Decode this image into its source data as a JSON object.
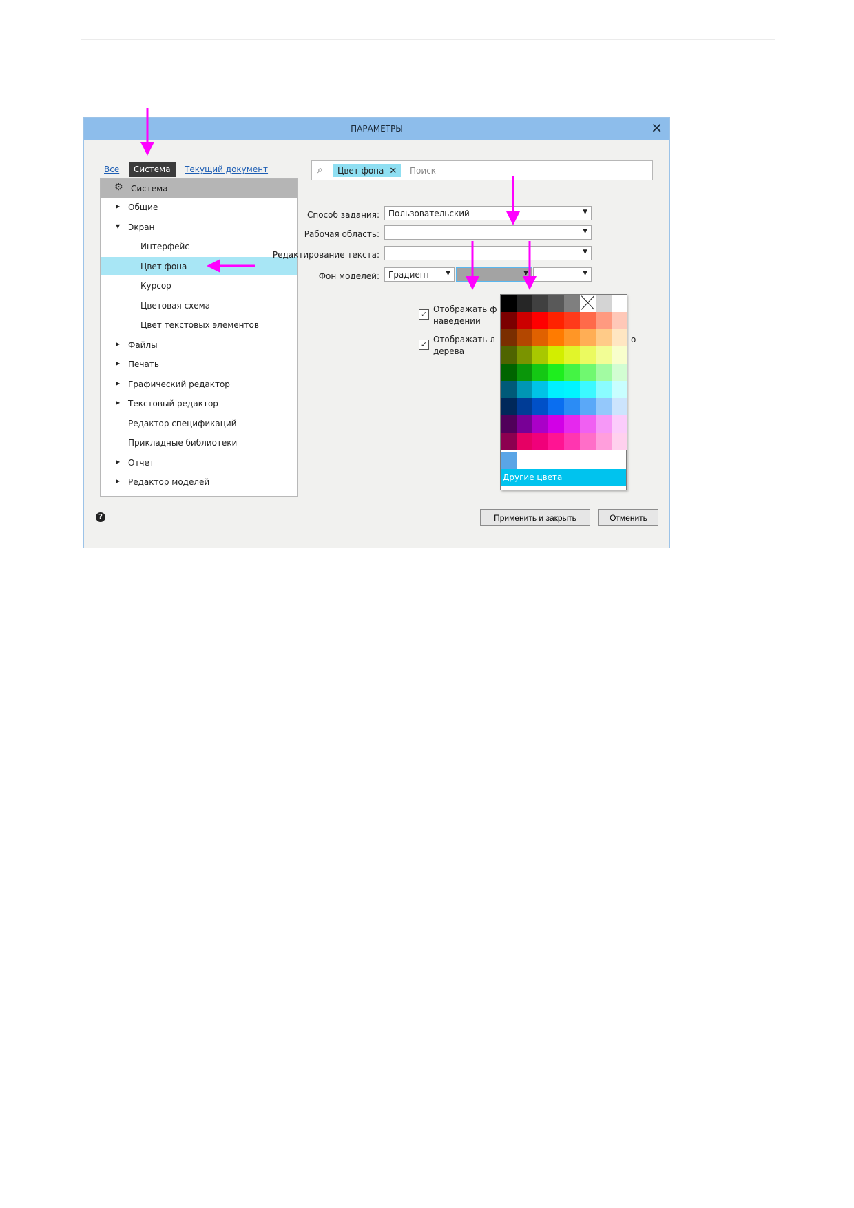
{
  "dialog": {
    "title": "ПАРАМЕТРЫ",
    "close": "✕"
  },
  "scope_tabs": {
    "all": "Все",
    "system": "Система",
    "current_document": "Текущий документ"
  },
  "search": {
    "chip_label": "Цвет фона",
    "chip_clear": "✕",
    "placeholder": "Поиск"
  },
  "tree": {
    "root": "Система",
    "items": [
      {
        "label": "Общие",
        "level": 1,
        "expander": "collapsed"
      },
      {
        "label": "Экран",
        "level": 1,
        "expander": "expanded"
      },
      {
        "label": "Интерфейс",
        "level": 2,
        "expander": "none"
      },
      {
        "label": "Цвет фона",
        "level": 2,
        "expander": "none",
        "selected": true
      },
      {
        "label": "Курсор",
        "level": 2,
        "expander": "none"
      },
      {
        "label": "Цветовая схема",
        "level": 2,
        "expander": "none"
      },
      {
        "label": "Цвет текстовых элементов",
        "level": 2,
        "expander": "none"
      },
      {
        "label": "Файлы",
        "level": 1,
        "expander": "collapsed"
      },
      {
        "label": "Печать",
        "level": 1,
        "expander": "collapsed"
      },
      {
        "label": "Графический редактор",
        "level": 1,
        "expander": "collapsed"
      },
      {
        "label": "Текстовый редактор",
        "level": 1,
        "expander": "collapsed"
      },
      {
        "label": "Редактор спецификаций",
        "level": 1,
        "expander": "none"
      },
      {
        "label": "Прикладные библиотеки",
        "level": 1,
        "expander": "none"
      },
      {
        "label": "Отчет",
        "level": 1,
        "expander": "collapsed"
      },
      {
        "label": "Редактор моделей",
        "level": 1,
        "expander": "collapsed"
      }
    ]
  },
  "form": {
    "method_label": "Способ задания:",
    "method_value": "Пользовательский",
    "workspace_label": "Рабочая область:",
    "workspace_value": "",
    "text_edit_label": "Редактирование текста:",
    "text_edit_value": "",
    "model_bg_label": "Фон моделей:",
    "model_bg_mode": "Градиент",
    "model_bg_color1": "#a3a3a3",
    "model_bg_color2": "",
    "check1_visible": "Отображать ф",
    "check1_line2": "наведении",
    "check2_visible": "Отображать л",
    "check2_tail": "о",
    "check2_line2": "дерева",
    "check1_checked": true,
    "check2_checked": true
  },
  "palette": {
    "rows": [
      [
        "#000000",
        "#262626",
        "#404040",
        "#595959",
        "#7f7f7f",
        "none",
        "#d4d4d4",
        "#ffffff"
      ],
      [
        "#7b0000",
        "#cc0000",
        "#ff0000",
        "#ff2200",
        "#ff3a1a",
        "#ff6a4a",
        "#ff9a80",
        "#ffc8b8"
      ],
      [
        "#7a2e00",
        "#b34700",
        "#e06100",
        "#ff7b00",
        "#ff9626",
        "#ffae55",
        "#ffcb88",
        "#ffe6c2"
      ],
      [
        "#4f6400",
        "#7a9400",
        "#a8c800",
        "#d2ee00",
        "#e1f52a",
        "#ebfa60",
        "#f2fd95",
        "#f8fecc"
      ],
      [
        "#006400",
        "#0a960a",
        "#14c814",
        "#1eee1e",
        "#44f444",
        "#70f870",
        "#a2fba2",
        "#d2fdd2"
      ],
      [
        "#005a78",
        "#0096b4",
        "#00c3e6",
        "#00f0ff",
        "#00f5ff",
        "#3cf9ff",
        "#8afcff",
        "#c8feff"
      ],
      [
        "#00285a",
        "#003c96",
        "#0050c8",
        "#0a6ef0",
        "#2b8cf5",
        "#5aa8f8",
        "#94c8fb",
        "#cce4fd"
      ],
      [
        "#50005a",
        "#780096",
        "#aa00c8",
        "#d200e6",
        "#e628ee",
        "#f060f2",
        "#f698f7",
        "#fbccfb"
      ],
      [
        "#8c0050",
        "#e60064",
        "#f0007a",
        "#ff1493",
        "#ff36b0",
        "#ff6ec8",
        "#ff9edc",
        "#ffd0ee"
      ]
    ],
    "recent_color": "#5aa5e6",
    "other_colors_label": "Другие цвета"
  },
  "buttons": {
    "help": "?",
    "apply_close": "Применить и закрыть",
    "cancel": "Отменить"
  },
  "annotation_color": "#ff00ff"
}
